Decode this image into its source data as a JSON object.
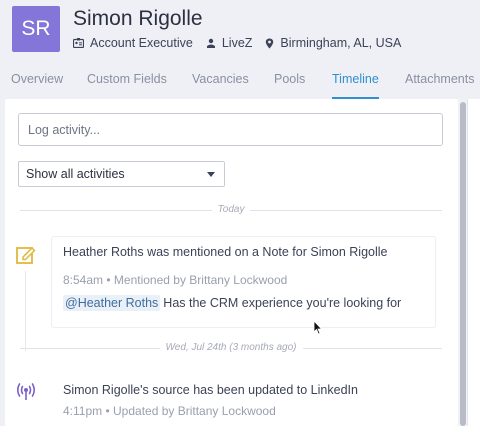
{
  "profile": {
    "initials": "SR",
    "name": "Simon Rigolle",
    "title": "Account Executive",
    "company": "LiveZ",
    "location": "Birmingham, AL, USA"
  },
  "tabs": [
    "Overview",
    "Custom Fields",
    "Vacancies",
    "Pools",
    "Timeline",
    "Attachments"
  ],
  "active_tab": "Timeline",
  "log": {
    "placeholder": "Log activity..."
  },
  "filter": {
    "selected": "Show all activities"
  },
  "timeline": {
    "groups": [
      {
        "date_label": "Today",
        "activities": [
          {
            "icon": "note-edit-icon",
            "title": "Heather Roths was mentioned on a Note for Simon Rigolle",
            "subtitle": "8:54am • Mentioned by Brittany Lockwood",
            "mention": "@Heather Roths",
            "body": "Has the CRM experience you're looking for"
          }
        ]
      },
      {
        "date_label": "Wed, Jul 24th (3 months ago)",
        "activities": [
          {
            "icon": "broadcast-icon",
            "title": "Simon Rigolle's source has been updated to LinkedIn",
            "subtitle": "4:11pm • Updated by Brittany Lockwood"
          }
        ]
      }
    ]
  },
  "colors": {
    "avatar": "#8476d9",
    "accent": "#2f8fd0",
    "note_icon": "#e0b83a",
    "broadcast_icon": "#7b5fc7"
  }
}
